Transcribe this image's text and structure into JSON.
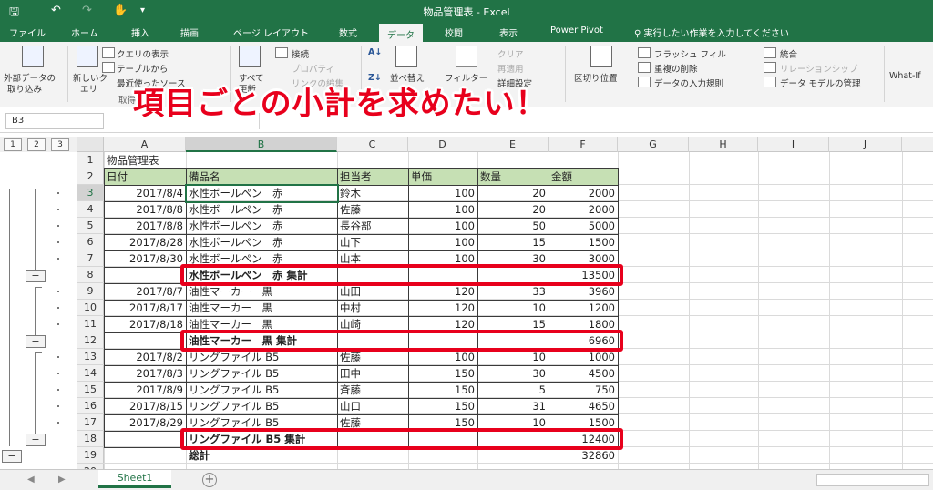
{
  "window": {
    "title": "物品管理表 - Excel"
  },
  "ribbon_tabs": [
    {
      "label": "ファイル",
      "active": false
    },
    {
      "label": "ホーム",
      "active": false
    },
    {
      "label": "挿入",
      "active": false
    },
    {
      "label": "描画",
      "active": false
    },
    {
      "label": "ページ レイアウト",
      "active": false
    },
    {
      "label": "数式",
      "active": false
    },
    {
      "label": "データ",
      "active": true
    },
    {
      "label": "校閲",
      "active": false
    },
    {
      "label": "表示",
      "active": false
    },
    {
      "label": "Power Pivot",
      "active": false
    }
  ],
  "tell_me": "♀ 実行したい作業を入力してください",
  "ribbon": {
    "ext_data": "外部データの",
    "ext_data2": "取り込み",
    "new_query": "新しいク",
    "new_query2": "エリ",
    "show_query": "クエリの表示",
    "from_table": "テーブルから",
    "recent_src": "最近使ったソース",
    "get_transform": "取得と変換",
    "refresh_all": "すべて",
    "refresh_all2": "更新",
    "connections": "接続",
    "properties": "プロパティ",
    "edit_links": "リンクの編集",
    "sort": "並べ替え",
    "filter": "フィルター",
    "clear": "クリア",
    "reapply": "再適用",
    "advanced": "詳細設定",
    "text_to_cols": "区切り位置",
    "flash_fill": "フラッシュ フィル",
    "remove_dup": "重複の削除",
    "data_valid": "データの入力規則",
    "consolidate": "統合",
    "relationships": "リレーションシップ",
    "data_model": "データ モデルの管理",
    "whatif": "What-If"
  },
  "banner": "項目ごとの小計を求めたい！",
  "name_box": "B3",
  "outline_levels": [
    "1",
    "2",
    "3"
  ],
  "columns": [
    "A",
    "B",
    "C",
    "D",
    "E",
    "F",
    "G",
    "H",
    "I",
    "J"
  ],
  "selected_column": "B",
  "sheet_title": "物品管理表",
  "table_headers": [
    "日付",
    "備品名",
    "担当者",
    "単価",
    "数量",
    "金額"
  ],
  "rows": [
    {
      "num": "3",
      "date": "2017/8/4",
      "item": "水性ボールペン　赤",
      "person": "鈴木",
      "price": "100",
      "qty": "20",
      "amount": "2000"
    },
    {
      "num": "4",
      "date": "2017/8/8",
      "item": "水性ボールペン　赤",
      "person": "佐藤",
      "price": "100",
      "qty": "20",
      "amount": "2000"
    },
    {
      "num": "5",
      "date": "2017/8/8",
      "item": "水性ボールペン　赤",
      "person": "長谷部",
      "price": "100",
      "qty": "50",
      "amount": "5000"
    },
    {
      "num": "6",
      "date": "2017/8/28",
      "item": "水性ボールペン　赤",
      "person": "山下",
      "price": "100",
      "qty": "15",
      "amount": "1500"
    },
    {
      "num": "7",
      "date": "2017/8/30",
      "item": "水性ボールペン　赤",
      "person": "山本",
      "price": "100",
      "qty": "30",
      "amount": "3000"
    },
    {
      "num": "8",
      "subtotal": true,
      "item": "水性ボールペン　赤 集計",
      "amount": "13500"
    },
    {
      "num": "9",
      "date": "2017/8/7",
      "item": "油性マーカー　黒",
      "person": "山田",
      "price": "120",
      "qty": "33",
      "amount": "3960"
    },
    {
      "num": "10",
      "date": "2017/8/17",
      "item": "油性マーカー　黒",
      "person": "中村",
      "price": "120",
      "qty": "10",
      "amount": "1200"
    },
    {
      "num": "11",
      "date": "2017/8/18",
      "item": "油性マーカー　黒",
      "person": "山崎",
      "price": "120",
      "qty": "15",
      "amount": "1800"
    },
    {
      "num": "12",
      "subtotal": true,
      "item": "油性マーカー　黒 集計",
      "amount": "6960"
    },
    {
      "num": "13",
      "date": "2017/8/2",
      "item": "リングファイル B5",
      "person": "佐藤",
      "price": "100",
      "qty": "10",
      "amount": "1000"
    },
    {
      "num": "14",
      "date": "2017/8/3",
      "item": "リングファイル B5",
      "person": "田中",
      "price": "150",
      "qty": "30",
      "amount": "4500"
    },
    {
      "num": "15",
      "date": "2017/8/9",
      "item": "リングファイル B5",
      "person": "斉藤",
      "price": "150",
      "qty": "5",
      "amount": "750"
    },
    {
      "num": "16",
      "date": "2017/8/15",
      "item": "リングファイル B5",
      "person": "山口",
      "price": "150",
      "qty": "31",
      "amount": "4650"
    },
    {
      "num": "17",
      "date": "2017/8/29",
      "item": "リングファイル B5",
      "person": "佐藤",
      "price": "150",
      "qty": "10",
      "amount": "1500"
    },
    {
      "num": "18",
      "subtotal": true,
      "item": "リングファイル B5 集計",
      "amount": "12400"
    },
    {
      "num": "19",
      "subtotal": true,
      "grand": true,
      "item": "総計",
      "amount": "32860"
    }
  ],
  "row_numbers_static": [
    "1",
    "2",
    "20"
  ],
  "sheet_tab": "Sheet1",
  "colors": {
    "excel_green": "#217346",
    "header_fill": "#c6e0b4",
    "highlight_red": "#e8001c"
  }
}
